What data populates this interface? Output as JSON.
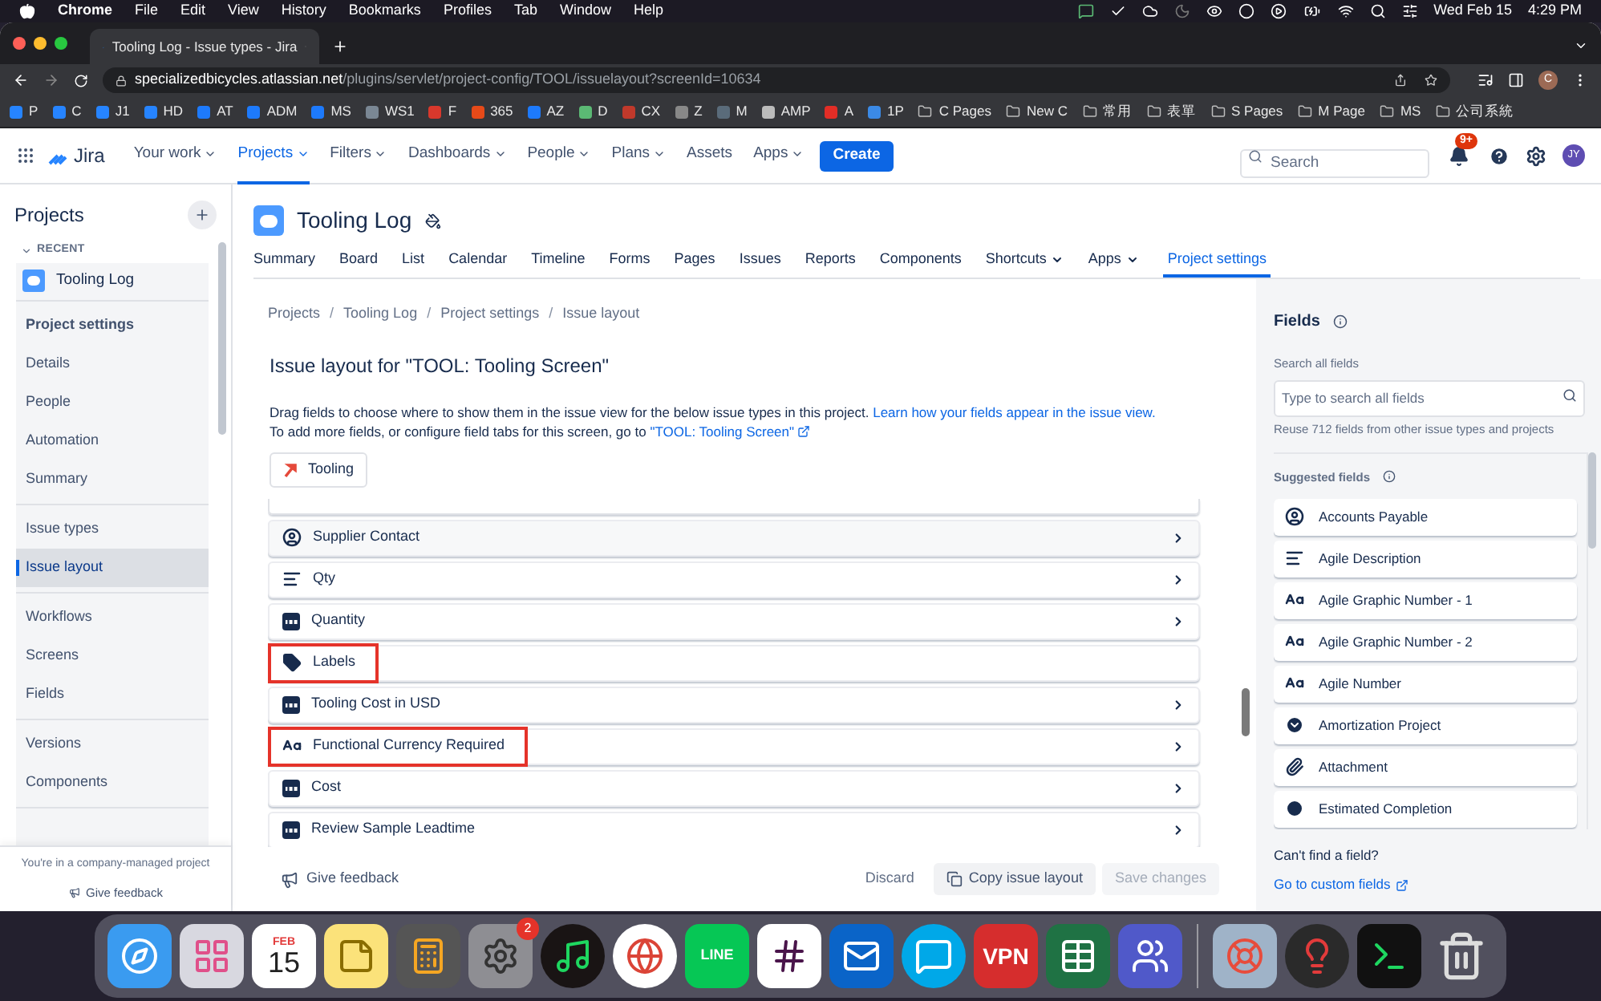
{
  "menubar": {
    "app": "Chrome",
    "menus": [
      "File",
      "Edit",
      "View",
      "History",
      "Bookmarks",
      "Profiles",
      "Tab",
      "Window",
      "Help"
    ],
    "date": "Wed Feb 15",
    "time": "4:29 PM"
  },
  "browser": {
    "tab_title": "Tooling Log - Issue types - Jira",
    "url_host": "specializedbicycles.atlassian.net",
    "url_path": "/plugins/servlet/project-config/TOOL/issuelayout?screenId=10634",
    "profile": "C",
    "bookmarks": [
      {
        "label": "P",
        "kind": "site",
        "color": "#2684ff"
      },
      {
        "label": "C",
        "kind": "site",
        "color": "#2684ff"
      },
      {
        "label": "J1",
        "kind": "site",
        "color": "#2684ff"
      },
      {
        "label": "HD",
        "kind": "site",
        "color": "#2684ff"
      },
      {
        "label": "AT",
        "kind": "site",
        "color": "#1d7afc"
      },
      {
        "label": "ADM",
        "kind": "site",
        "color": "#1d7afc"
      },
      {
        "label": "MS",
        "kind": "site",
        "color": "#1d7afc"
      },
      {
        "label": "WS1",
        "kind": "site",
        "color": "#7a8794"
      },
      {
        "label": "F",
        "kind": "site",
        "color": "#d9382c"
      },
      {
        "label": "365",
        "kind": "site",
        "color": "#e64a19"
      },
      {
        "label": "AZ",
        "kind": "site",
        "color": "#1d7afc"
      },
      {
        "label": "D",
        "kind": "site",
        "color": "#5bb974"
      },
      {
        "label": "CX",
        "kind": "site",
        "color": "#c0392b"
      },
      {
        "label": "Z",
        "kind": "site",
        "color": "#888888"
      },
      {
        "label": "M",
        "kind": "site",
        "color": "#5a6b7a"
      },
      {
        "label": "AMP",
        "kind": "site",
        "color": "#bbbbbb"
      },
      {
        "label": "A",
        "kind": "site",
        "color": "#e22d26"
      },
      {
        "label": "1P",
        "kind": "site",
        "color": "#3b8ae6"
      },
      {
        "label": "C Pages",
        "kind": "folder",
        "color": "#bdbdbd"
      },
      {
        "label": "New C",
        "kind": "folder",
        "color": "#bdbdbd"
      },
      {
        "label": "常用",
        "kind": "folder",
        "color": "#bdbdbd"
      },
      {
        "label": "表單",
        "kind": "folder",
        "color": "#bdbdbd"
      },
      {
        "label": "S Pages",
        "kind": "folder",
        "color": "#bdbdbd"
      },
      {
        "label": "M Page",
        "kind": "folder",
        "color": "#bdbdbd"
      },
      {
        "label": "MS",
        "kind": "folder",
        "color": "#bdbdbd"
      },
      {
        "label": "公司系統",
        "kind": "folder",
        "color": "#bdbdbd"
      }
    ]
  },
  "jira_nav": {
    "logo": "Jira",
    "items": [
      {
        "label": "Your work",
        "dropdown": true,
        "selected": false
      },
      {
        "label": "Projects",
        "dropdown": true,
        "selected": true
      },
      {
        "label": "Filters",
        "dropdown": true,
        "selected": false
      },
      {
        "label": "Dashboards",
        "dropdown": true,
        "selected": false
      },
      {
        "label": "People",
        "dropdown": true,
        "selected": false
      },
      {
        "label": "Plans",
        "dropdown": true,
        "selected": false
      },
      {
        "label": "Assets",
        "dropdown": false,
        "selected": false
      },
      {
        "label": "Apps",
        "dropdown": true,
        "selected": false
      }
    ],
    "create": "Create",
    "search_placeholder": "Search",
    "notification_badge": "9+",
    "avatar": "JY"
  },
  "sidebar": {
    "title": "Projects",
    "recent_label": "RECENT",
    "project": "Tooling Log",
    "sections": [
      [
        {
          "label": "Project settings",
          "kind": "heading"
        },
        {
          "label": "Details",
          "kind": "link",
          "selected": false
        },
        {
          "label": "People",
          "kind": "link",
          "selected": false
        },
        {
          "label": "Automation",
          "kind": "link",
          "selected": false
        },
        {
          "label": "Summary",
          "kind": "link",
          "selected": false
        }
      ],
      [
        {
          "label": "Issue types",
          "kind": "link",
          "selected": false
        },
        {
          "label": "Issue layout",
          "kind": "link",
          "selected": true
        }
      ],
      [
        {
          "label": "Workflows",
          "kind": "link",
          "selected": false
        },
        {
          "label": "Screens",
          "kind": "link",
          "selected": false
        },
        {
          "label": "Fields",
          "kind": "link",
          "selected": false
        }
      ],
      [
        {
          "label": "Versions",
          "kind": "link",
          "selected": false
        },
        {
          "label": "Components",
          "kind": "link",
          "selected": false
        }
      ]
    ],
    "footer_note": "You're in a company-managed project",
    "feedback": "Give feedback"
  },
  "project": {
    "title": "Tooling Log",
    "tabs": [
      {
        "label": "Summary",
        "dropdown": false,
        "selected": false
      },
      {
        "label": "Board",
        "dropdown": false,
        "selected": false
      },
      {
        "label": "List",
        "dropdown": false,
        "selected": false
      },
      {
        "label": "Calendar",
        "dropdown": false,
        "selected": false
      },
      {
        "label": "Timeline",
        "dropdown": false,
        "selected": false
      },
      {
        "label": "Forms",
        "dropdown": false,
        "selected": false
      },
      {
        "label": "Pages",
        "dropdown": false,
        "selected": false
      },
      {
        "label": "Issues",
        "dropdown": false,
        "selected": false
      },
      {
        "label": "Reports",
        "dropdown": false,
        "selected": false
      },
      {
        "label": "Components",
        "dropdown": false,
        "selected": false
      },
      {
        "label": "Shortcuts",
        "dropdown": true,
        "selected": false
      },
      {
        "label": "Apps",
        "dropdown": true,
        "selected": false
      },
      {
        "label": "Project settings",
        "dropdown": false,
        "selected": true
      }
    ]
  },
  "layout": {
    "breadcrumbs": [
      "Projects",
      "Tooling Log",
      "Project settings",
      "Issue layout"
    ],
    "breadcrumb_separator": "/",
    "heading": "Issue layout for \"TOOL: Tooling Screen\"",
    "description": "Drag fields to choose where to show them in the issue view for the below issue types in this project.",
    "learn_link": "Learn how your fields appear in the issue view.",
    "description_2": "To add more fields, or configure field tabs for this screen, go to",
    "screen_link": "\"TOOL: Tooling Screen\"",
    "issue_type": "Tooling",
    "fields": [
      {
        "label": "Supplier Contact",
        "kind": "user",
        "expandable": true,
        "hovered": true,
        "highlighted": false
      },
      {
        "label": "Qty",
        "kind": "paragraph",
        "expandable": true,
        "hovered": false,
        "highlighted": false
      },
      {
        "label": "Quantity",
        "kind": "number",
        "expandable": true,
        "hovered": false,
        "highlighted": false
      },
      {
        "label": "Labels",
        "kind": "labels",
        "expandable": false,
        "hovered": false,
        "highlighted": true
      },
      {
        "label": "Tooling Cost in USD",
        "kind": "number",
        "expandable": true,
        "hovered": false,
        "highlighted": false
      },
      {
        "label": "Functional Currency Required",
        "kind": "text",
        "expandable": true,
        "hovered": false,
        "highlighted": true
      },
      {
        "label": "Cost",
        "kind": "number",
        "expandable": true,
        "hovered": false,
        "highlighted": false
      },
      {
        "label": "Review Sample Leadtime",
        "kind": "number",
        "expandable": true,
        "hovered": false,
        "highlighted": false
      }
    ],
    "feedback": "Give feedback",
    "buttons": [
      {
        "label": "Discard",
        "kind": "subtle",
        "disabled": false
      },
      {
        "label": "Copy issue layout",
        "kind": "copy",
        "disabled": false
      },
      {
        "label": "Save changes",
        "kind": "primary",
        "disabled": true
      }
    ]
  },
  "fields_panel": {
    "title": "Fields",
    "search_label": "Search all fields",
    "search_placeholder": "Type to search all fields",
    "hint": "Reuse 712 fields from other issue types and projects",
    "suggested_title": "Suggested fields",
    "suggested": [
      {
        "label": "Accounts Payable",
        "kind": "user"
      },
      {
        "label": "Agile Description",
        "kind": "paragraph"
      },
      {
        "label": "Agile Graphic Number - 1",
        "kind": "text"
      },
      {
        "label": "Agile Graphic Number - 2",
        "kind": "text"
      },
      {
        "label": "Agile Number",
        "kind": "text"
      },
      {
        "label": "Amortization Project",
        "kind": "select"
      },
      {
        "label": "Attachment",
        "kind": "attachment"
      },
      {
        "label": "Estimated Completion",
        "kind": "date"
      }
    ],
    "cant_find": "Can't find a field?",
    "custom_link": "Go to custom fields"
  },
  "dock": [
    {
      "kind": "finder"
    },
    {
      "kind": "launchpad"
    },
    {
      "kind": "calendar",
      "month": "FEB",
      "day": "15"
    },
    {
      "kind": "notes"
    },
    {
      "kind": "calculator"
    },
    {
      "kind": "settings",
      "badge": "2"
    },
    {
      "kind": "spotify"
    },
    {
      "kind": "chrome"
    },
    {
      "kind": "line",
      "text": "LINE"
    },
    {
      "kind": "slack"
    },
    {
      "kind": "outlook"
    },
    {
      "kind": "skype"
    },
    {
      "kind": "vpn",
      "text": "VPN"
    },
    {
      "kind": "excel"
    },
    {
      "kind": "teams"
    },
    {
      "kind": "separator"
    },
    {
      "kind": "lifebuoy"
    },
    {
      "kind": "bulb"
    },
    {
      "kind": "terminal"
    },
    {
      "kind": "trash"
    }
  ]
}
